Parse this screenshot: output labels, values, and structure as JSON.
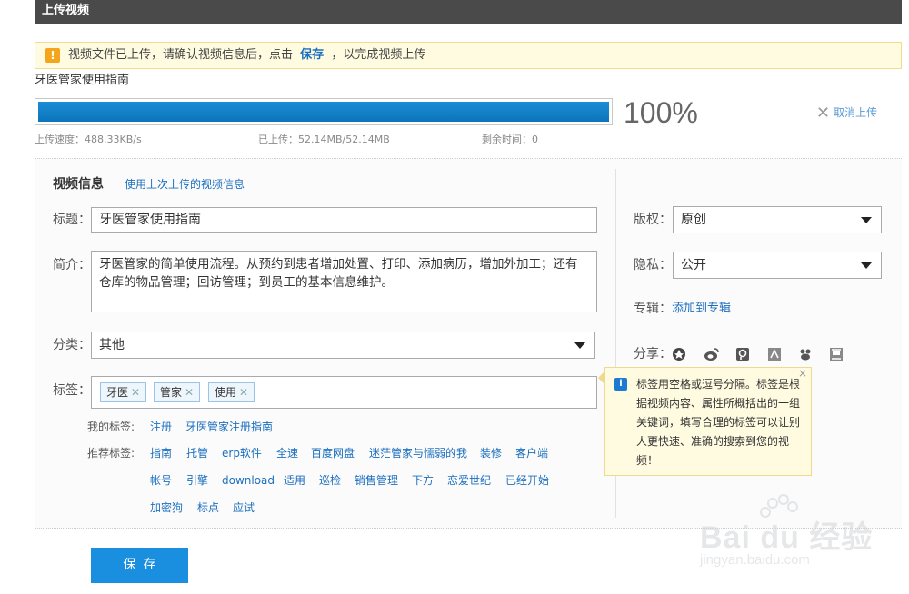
{
  "header": {
    "title": "上传视频"
  },
  "notice": {
    "icon": "warning-icon",
    "text_before": "视频文件已上传，请确认视频信息后，点击",
    "save_word": "保存",
    "text_after": "，以完成视频上传"
  },
  "upload": {
    "filename": "牙医管家使用指南",
    "progress_fraction": 1.0,
    "percent_text": "100%",
    "cancel_label": "取消上传",
    "speed": "上传速度：488.33KB/s",
    "uploaded": "已上传：52.14MB/52.14MB",
    "remaining": "剩余时间：0"
  },
  "info": {
    "section_title": "视频信息",
    "reuse_link": "使用上次上传的视频信息",
    "title_label": "标题：",
    "title_value": "牙医管家使用指南",
    "desc_label": "简介：",
    "desc_value": "牙医管家的简单使用流程。从预约到患者增加处置、打印、添加病历，增加外加工；还有仓库的物品管理；回访管理；到员工的基本信息维护。",
    "category_label": "分类：",
    "category_value": "其他",
    "tags_label": "标签：",
    "tags": [
      "牙医",
      "管家",
      "使用"
    ],
    "my_tags_label": "我的标签:",
    "my_tags": [
      "注册",
      "牙医管家注册指南"
    ],
    "rec_tags_label": "推荐标签:",
    "rec_tags_row1": [
      "指南",
      "托管",
      "erp软件",
      "全速",
      "百度网盘",
      "迷茫管家与懦弱的我",
      "装修",
      "客户端"
    ],
    "rec_tags_row2": [
      "帐号",
      "引擎",
      "download",
      "适用",
      "巡检",
      "销售管理",
      "下方",
      "恋爱世纪",
      "已经开始"
    ],
    "rec_tags_row3": [
      "加密狗",
      "标点",
      "应试"
    ]
  },
  "side": {
    "copyright_label": "版权：",
    "copyright_value": "原创",
    "privacy_label": "隐私：",
    "privacy_value": "公开",
    "album_label": "专辑：",
    "album_link": "添加到专辑",
    "share_label": "分享：",
    "share_icons": [
      "qzone-icon",
      "weibo-icon",
      "tencent-weibo-icon",
      "renren-icon",
      "kaixin-icon",
      "douban-icon"
    ]
  },
  "tip": {
    "text": "标签用空格或逗号分隔。标签是根据视频内容、属性所概括出的一组关键词，填写合理的标签可以让别人更快速、准确的搜索到您的视频！",
    "close": "×"
  },
  "save_button": "保存",
  "watermark": {
    "main": "Bai du 经验",
    "sub": "jingyan.baidu.com"
  }
}
